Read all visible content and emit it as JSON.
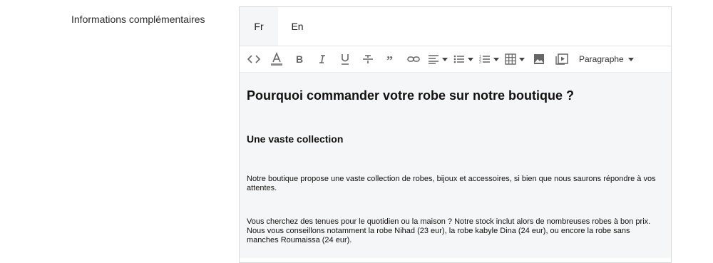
{
  "field": {
    "label": "Informations complémentaires"
  },
  "tabs": [
    {
      "label": "Fr",
      "active": true
    },
    {
      "label": "En",
      "active": false
    }
  ],
  "toolbar": {
    "icons": [
      "code-icon",
      "text-color-icon",
      "bold-icon",
      "italic-icon",
      "underline-icon",
      "strikethrough-icon",
      "quote-icon",
      "link-icon",
      "align-icon",
      "bullet-list-icon",
      "numbered-list-icon",
      "table-icon",
      "image-icon",
      "video-icon"
    ],
    "block_format": "Paragraphe",
    "text_color_accent": "#8a8a8a"
  },
  "content": {
    "heading": "Pourquoi commander votre robe sur notre boutique ?",
    "subheading": "Une vaste collection",
    "paragraph_1": "Notre boutique propose une vaste collection de robes, bijoux et accessoires, si bien que nous saurons répondre à vos attentes.",
    "paragraph_2": "Vous cherchez des tenues pour le quotidien ou la maison ? Notre stock inclut alors de nombreuses robes à bon prix. Nous vous conseillons notamment la robe Nihad (23 eur), la robe kabyle Dina (24 eur), ou encore la robe sans manches Roumaissa (24 eur)."
  }
}
